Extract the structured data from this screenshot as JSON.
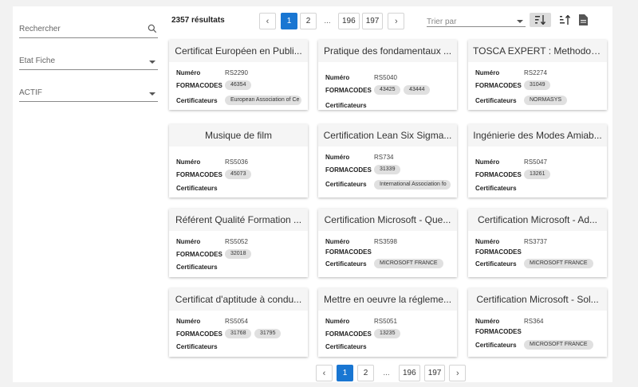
{
  "filters": {
    "search_label": "Rechercher",
    "etat_label": "Etat Fiche",
    "actif_label": "ACTIF"
  },
  "results": {
    "count": "2357 résultats"
  },
  "pagination": {
    "prev": "‹",
    "next": "›",
    "pages": [
      "1",
      "2",
      "...",
      "196",
      "197"
    ],
    "active": "1"
  },
  "sort": {
    "label": "Trier par"
  },
  "icons": [
    "search-icon",
    "chevron-down-icon",
    "sort-ascending-icon",
    "sort-descending-icon",
    "document-icon",
    "chevron-left-icon",
    "chevron-right-icon"
  ],
  "field_labels": {
    "numero": "Numéro",
    "formacodes": "FORMACODES",
    "certificateurs": "Certificateurs"
  },
  "cards": [
    {
      "title": "Certificat Européen en Publi...",
      "numero": "RS2290",
      "formacodes": [
        "46354"
      ],
      "certificateurs": [
        "European Association of Ce"
      ]
    },
    {
      "title": "Pratique des fondamentaux ...",
      "numero": "RS5040",
      "formacodes": [
        "43425",
        "43444"
      ],
      "certificateurs": []
    },
    {
      "title": "TOSCA EXPERT : Methodolo...",
      "numero": "RS2274",
      "formacodes": [
        "31049"
      ],
      "certificateurs": [
        "NORMASYS"
      ]
    },
    {
      "title": "Musique de film",
      "numero": "RS5036",
      "formacodes": [
        "45073"
      ],
      "certificateurs": []
    },
    {
      "title": "Certification Lean Six Sigma...",
      "numero": "RS734",
      "formacodes": [
        "31339"
      ],
      "certificateurs": [
        "International Association fo"
      ]
    },
    {
      "title": "Ingénierie des Modes Amiab...",
      "numero": "RS5047",
      "formacodes": [
        "13261"
      ],
      "certificateurs": []
    },
    {
      "title": "Référent Qualité Formation ...",
      "numero": "RS5052",
      "formacodes": [
        "32018"
      ],
      "certificateurs": []
    },
    {
      "title": "Certification Microsoft - Que...",
      "numero": "RS3598",
      "formacodes": [],
      "certificateurs": [
        "MICROSOFT FRANCE"
      ]
    },
    {
      "title": "Certification Microsoft - Ad...",
      "numero": "RS3737",
      "formacodes": [],
      "certificateurs": [
        "MICROSOFT FRANCE"
      ]
    },
    {
      "title": "Certificat d'aptitude à condu...",
      "numero": "RS5054",
      "formacodes": [
        "31768",
        "31795"
      ],
      "certificateurs": []
    },
    {
      "title": "Mettre en oeuvre la régleme...",
      "numero": "RS5051",
      "formacodes": [
        "13235"
      ],
      "certificateurs": []
    },
    {
      "title": "Certification Microsoft - Sol...",
      "numero": "RS364",
      "formacodes": [],
      "certificateurs": [
        "MICROSOFT FRANCE"
      ]
    }
  ],
  "colors": {
    "accent": "#1976d2",
    "chip": "#e0e0e0",
    "card_header": "#f5f5f5"
  }
}
